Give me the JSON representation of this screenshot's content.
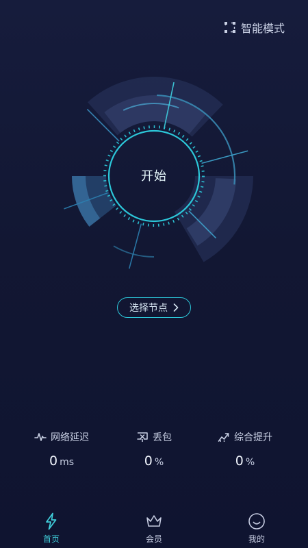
{
  "header": {
    "mode_label": "智能模式",
    "mode_icon": "smart-mode-icon"
  },
  "dial": {
    "start_label": "开始"
  },
  "node_selector": {
    "label": "选择节点",
    "icon": "chevron-right-icon"
  },
  "stats": [
    {
      "label": "网络延迟",
      "value": "0",
      "unit": "ms",
      "icon": "pulse-icon"
    },
    {
      "label": "丢包",
      "value": "0",
      "unit": "%",
      "icon": "packet-loss-icon"
    },
    {
      "label": "综合提升",
      "value": "0",
      "unit": "%",
      "icon": "trend-up-icon"
    }
  ],
  "tabbar": [
    {
      "label": "首页",
      "icon": "lightning-icon",
      "active": true
    },
    {
      "label": "会员",
      "icon": "crown-icon",
      "active": false
    },
    {
      "label": "我的",
      "icon": "smile-icon",
      "active": false
    }
  ],
  "colors": {
    "accent": "#2cc6d8",
    "active_tab": "#40d0dc",
    "background": "#141a38"
  }
}
